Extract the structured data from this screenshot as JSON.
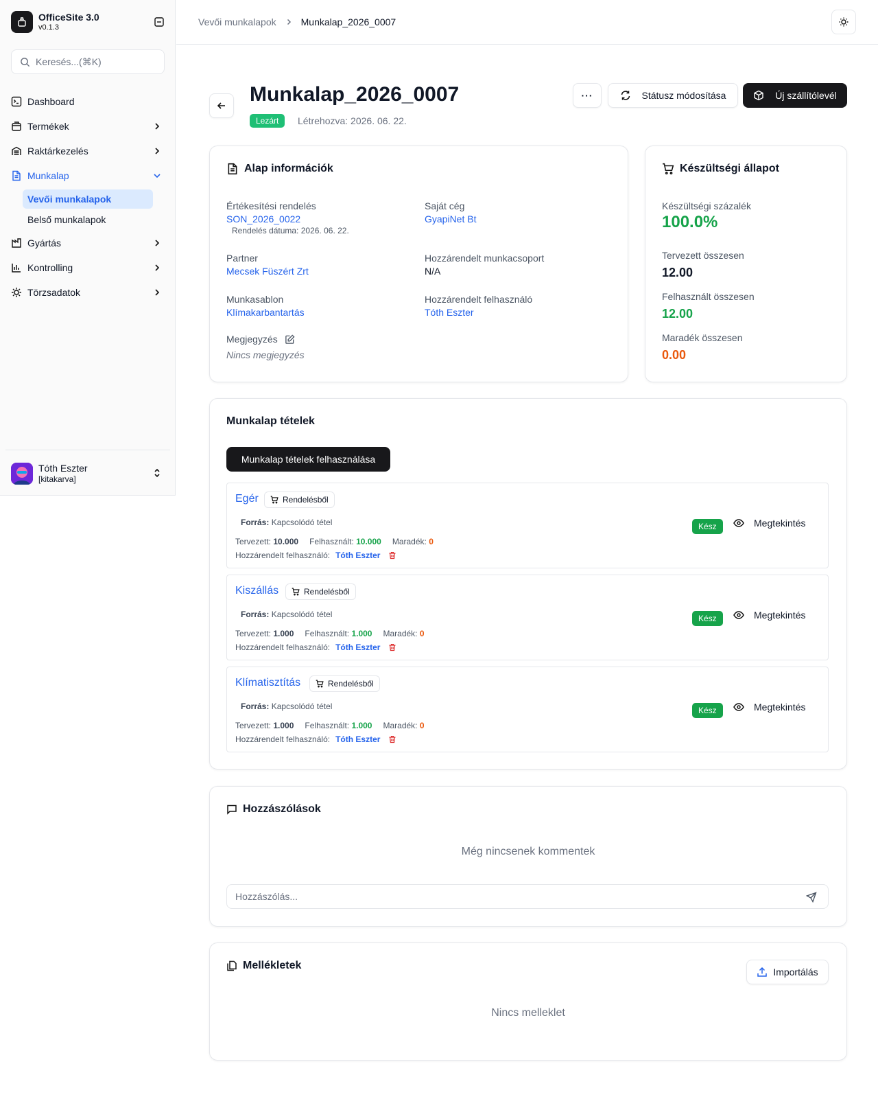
{
  "app": {
    "name": "OfficeSite 3.0",
    "version": "v0.1.3"
  },
  "search": {
    "placeholder": "Keresés...(⌘K)"
  },
  "sidebar": {
    "items": [
      {
        "label": "Dashboard",
        "icon": "terminal-icon"
      },
      {
        "label": "Termékek",
        "icon": "package-icon"
      },
      {
        "label": "Raktárkezelés",
        "icon": "warehouse-icon"
      },
      {
        "label": "Munkalap",
        "icon": "file-text-icon"
      },
      {
        "label": "Gyártás",
        "icon": "factory-icon"
      },
      {
        "label": "Kontrolling",
        "icon": "bar-chart-icon"
      },
      {
        "label": "Törzsadatok",
        "icon": "cog-icon"
      }
    ],
    "sub_items": [
      {
        "label": "Vevői munkalapok",
        "active": true
      },
      {
        "label": "Belső munkalapok",
        "active": false
      }
    ],
    "user": {
      "name": "Tóth Eszter",
      "login": "[kitakarva]"
    }
  },
  "breadcrumb": {
    "parent": "Vevői munkalapok",
    "current": "Munkalap_2026_0007"
  },
  "header": {
    "title": "Munkalap_2026_0007",
    "status": "Lezárt",
    "created": "Létrehozva: 2026. 06. 22.",
    "more_label": "···",
    "status_button": "Státusz módosítása",
    "new_delivery_button": "Új szállítólevél"
  },
  "basic_info": {
    "title": "Alap információk",
    "sales_order_label": "Értékesítési rendelés",
    "sales_order_value": "SON_2026_0022",
    "order_date": "Rendelés dátuma: 2026. 06. 22.",
    "own_company_label": "Saját cég",
    "own_company_value": "GyapiNet Bt",
    "partner_label": "Partner",
    "partner_value": "Mecsek Füszért Zrt",
    "work_group_label": "Hozzárendelt munkacsoport",
    "work_group_value": "N/A",
    "template_label": "Munkasablon",
    "template_value": "Klímakarbantartás",
    "user_label": "Hozzárendelt felhasználó",
    "user_value": "Tóth Eszter",
    "note_label": "Megjegyzés",
    "note_value": "Nincs megjegyzés"
  },
  "progress": {
    "title": "Készültségi állapot",
    "percent_label": "Készültségi százalék",
    "percent_value": "100.0%",
    "planned_label": "Tervezett összesen",
    "planned_value": "12.00",
    "used_label": "Felhasznált összesen",
    "used_value": "12.00",
    "remaining_label": "Maradék összesen",
    "remaining_value": "0.00"
  },
  "items_section": {
    "title": "Munkalap tételek",
    "use_button": "Munkalap tételek felhasználása",
    "tag_label": "Rendelésből",
    "source_label": "Forrás:",
    "source_value": "Kapcsolódó tétel",
    "planned_label": "Tervezett:",
    "used_label": "Felhasznált:",
    "remaining_label": "Maradék:",
    "assigned_label": "Hozzárendelt felhasználó:",
    "status_label": "Kész",
    "view_label": "Megtekintés",
    "items": [
      {
        "name": "Egér",
        "planned": "10.000",
        "used": "10.000",
        "remaining": "0",
        "user": "Tóth Eszter"
      },
      {
        "name": "Kiszállás",
        "planned": "1.000",
        "used": "1.000",
        "remaining": "0",
        "user": "Tóth Eszter"
      },
      {
        "name": "Klímatisztítás",
        "planned": "1.000",
        "used": "1.000",
        "remaining": "0",
        "user": "Tóth Eszter"
      }
    ]
  },
  "comments": {
    "title": "Hozzászólások",
    "empty": "Még nincsenek kommentek",
    "placeholder": "Hozzászólás..."
  },
  "attachments": {
    "title": "Mellékletek",
    "import_button": "Importálás",
    "empty": "Nincs melleklet"
  },
  "colors": {
    "accent": "#2563eb",
    "success": "#16a34a",
    "warning": "#ea580c",
    "dark": "#18181b"
  }
}
